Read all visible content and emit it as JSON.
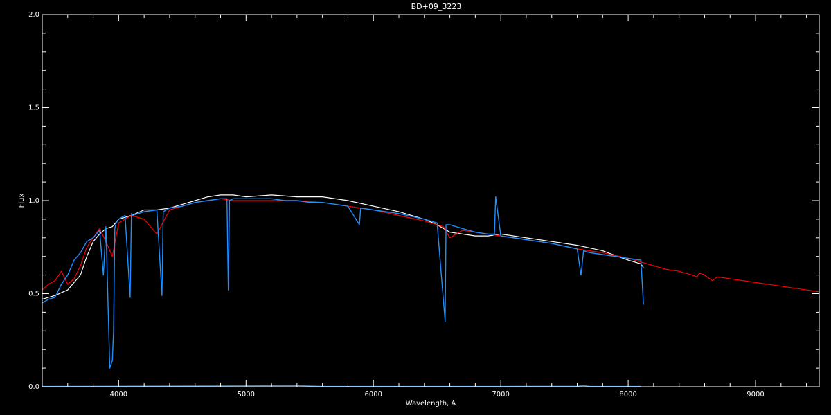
{
  "chart_data": {
    "type": "line",
    "title": "BD+09_3223",
    "xlabel": "Wavelength, A",
    "ylabel": "Flux",
    "xlim": [
      3400,
      9500
    ],
    "ylim": [
      0.0,
      2.0
    ],
    "x_ticks": [
      4000,
      5000,
      6000,
      7000,
      8000,
      9000
    ],
    "x_tick_labels": [
      "4000",
      "5000",
      "6000",
      "7000",
      "8000",
      "9000"
    ],
    "y_ticks": [
      0.0,
      0.5,
      1.0,
      1.5,
      2.0
    ],
    "y_tick_labels": [
      "0.0",
      "0.5",
      "1.0",
      "1.5",
      "2.0"
    ],
    "grid": false,
    "background": "#000000",
    "series": [
      {
        "color": "#ffffff",
        "x": [
          3400,
          3500,
          3600,
          3700,
          3750,
          3800,
          3850,
          3900,
          3950,
          4000,
          4100,
          4200,
          4300,
          4400,
          4500,
          4600,
          4700,
          4800,
          4900,
          5000,
          5200,
          5400,
          5600,
          5800,
          6000,
          6200,
          6400,
          6500,
          6600,
          6700,
          6800,
          6900,
          7000,
          7200,
          7400,
          7600,
          7800,
          8000,
          8100,
          8120
        ],
        "y": [
          0.47,
          0.49,
          0.52,
          0.6,
          0.7,
          0.78,
          0.82,
          0.85,
          0.86,
          0.9,
          0.92,
          0.95,
          0.95,
          0.96,
          0.98,
          1.0,
          1.02,
          1.03,
          1.03,
          1.02,
          1.03,
          1.02,
          1.02,
          1.0,
          0.97,
          0.94,
          0.9,
          0.87,
          0.83,
          0.82,
          0.81,
          0.81,
          0.82,
          0.8,
          0.78,
          0.76,
          0.73,
          0.68,
          0.66,
          0.64
        ]
      },
      {
        "color": "#ff0000",
        "x": [
          3400,
          3450,
          3500,
          3550,
          3600,
          3650,
          3700,
          3750,
          3800,
          3850,
          3900,
          3950,
          4000,
          4100,
          4200,
          4300,
          4400,
          4500,
          4600,
          4700,
          4800,
          4900,
          5000,
          5200,
          5400,
          5600,
          5800,
          6000,
          6200,
          6400,
          6550,
          6600,
          6700,
          6800,
          7000,
          7200,
          7400,
          7600,
          7800,
          8000,
          8100,
          8200,
          8300,
          8400,
          8500,
          8540,
          8560,
          8600,
          8660,
          8700,
          8800,
          9000,
          9200,
          9500
        ],
        "y": [
          0.52,
          0.55,
          0.57,
          0.62,
          0.55,
          0.58,
          0.65,
          0.75,
          0.8,
          0.85,
          0.78,
          0.7,
          0.88,
          0.92,
          0.9,
          0.82,
          0.95,
          0.97,
          0.99,
          1.0,
          1.01,
          1.0,
          1.0,
          1.0,
          1.0,
          0.99,
          0.97,
          0.95,
          0.92,
          0.89,
          0.86,
          0.8,
          0.84,
          0.83,
          0.81,
          0.79,
          0.77,
          0.74,
          0.72,
          0.69,
          0.67,
          0.65,
          0.63,
          0.62,
          0.6,
          0.59,
          0.61,
          0.6,
          0.57,
          0.59,
          0.58,
          0.56,
          0.54,
          0.51
        ]
      },
      {
        "color": "#1e90ff",
        "x": [
          3400,
          3450,
          3500,
          3550,
          3600,
          3650,
          3700,
          3750,
          3800,
          3850,
          3880,
          3900,
          3930,
          3950,
          3960,
          3970,
          3980,
          4000,
          4050,
          4090,
          4100,
          4110,
          4200,
          4300,
          4340,
          4350,
          4400,
          4500,
          4600,
          4700,
          4800,
          4850,
          4861,
          4870,
          4900,
          5000,
          5100,
          5200,
          5300,
          5400,
          5500,
          5600,
          5800,
          5890,
          5900,
          6000,
          6200,
          6400,
          6500,
          6563,
          6570,
          6600,
          6700,
          6800,
          6900,
          6950,
          6960,
          7000,
          7200,
          7400,
          7600,
          7630,
          7650,
          7700,
          7800,
          8000,
          8100,
          8120
        ],
        "y": [
          0.45,
          0.47,
          0.48,
          0.55,
          0.6,
          0.68,
          0.72,
          0.78,
          0.8,
          0.84,
          0.6,
          0.86,
          0.1,
          0.14,
          0.3,
          0.85,
          0.88,
          0.9,
          0.92,
          0.48,
          0.93,
          0.92,
          0.94,
          0.95,
          0.49,
          0.94,
          0.96,
          0.97,
          0.99,
          1.0,
          1.01,
          1.01,
          0.52,
          1.0,
          1.01,
          1.01,
          1.01,
          1.01,
          1.0,
          1.0,
          0.99,
          0.99,
          0.97,
          0.87,
          0.96,
          0.95,
          0.93,
          0.9,
          0.88,
          0.35,
          0.87,
          0.87,
          0.85,
          0.83,
          0.82,
          0.82,
          1.02,
          0.81,
          0.79,
          0.77,
          0.74,
          0.6,
          0.73,
          0.72,
          0.71,
          0.69,
          0.68,
          0.44
        ]
      },
      {
        "color": "#1e90ff",
        "x": [
          3400,
          4000,
          5000,
          5400,
          5600,
          6000,
          7000,
          7600,
          7650,
          7700,
          8100
        ],
        "y": [
          0.002,
          0.003,
          0.005,
          0.006,
          0.002,
          0.002,
          0.002,
          0.003,
          0.006,
          0.002,
          0.002
        ]
      }
    ]
  }
}
